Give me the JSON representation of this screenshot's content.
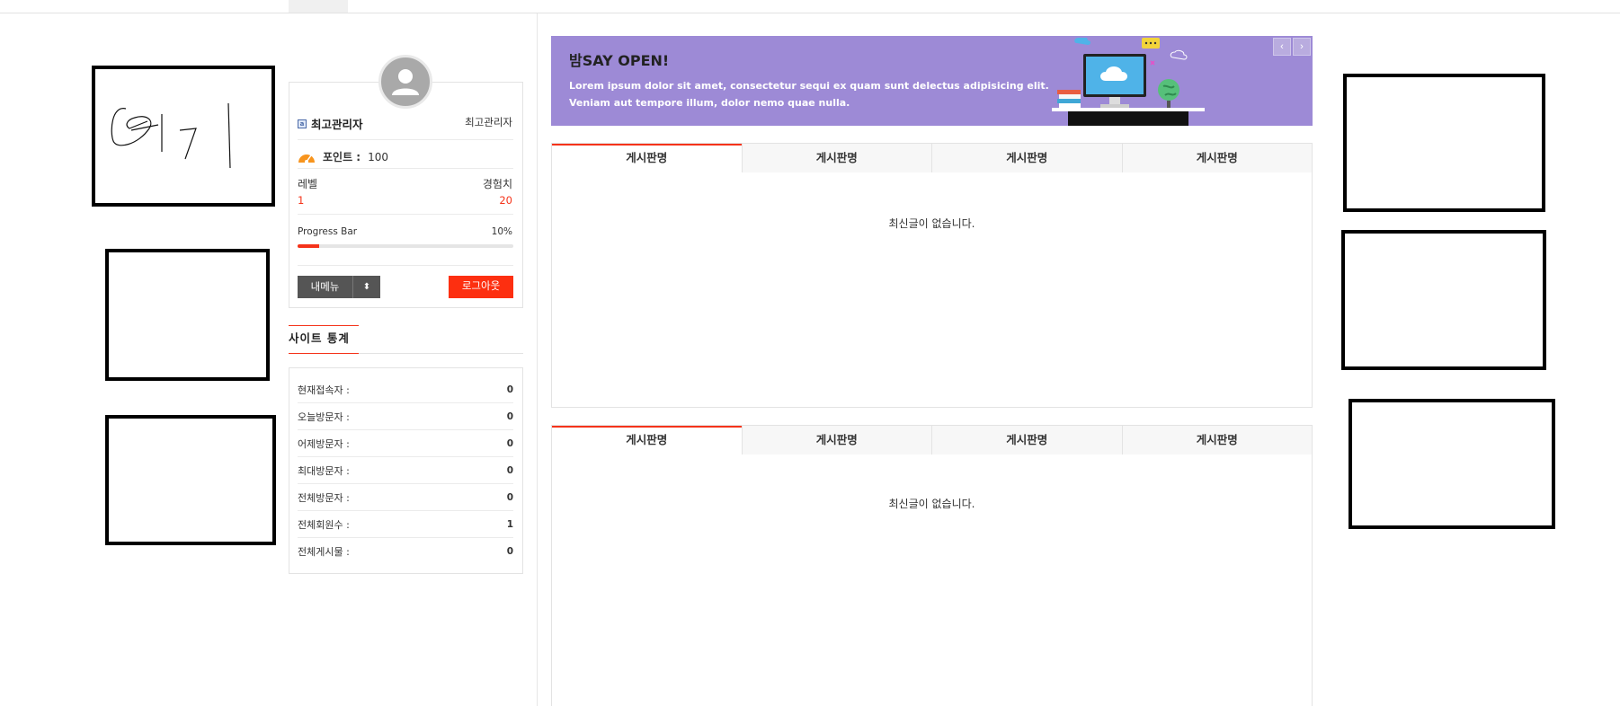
{
  "profile": {
    "name": "최고관리자",
    "role": "최고관리자",
    "points_label": "포인트 :",
    "points_value": "100",
    "level_label": "레벨",
    "level_value": "1",
    "exp_label": "경험치",
    "exp_value": "20",
    "progress_label": "Progress Bar",
    "progress_text": "10%",
    "progress_fraction": 0.1,
    "mymenu_label": "내메뉴",
    "logout_label": "로그아웃"
  },
  "stats": {
    "title": "사이트 통계",
    "rows": [
      {
        "label": "현재접속자 :",
        "value": "0"
      },
      {
        "label": "오늘방문자 :",
        "value": "0"
      },
      {
        "label": "어제방문자 :",
        "value": "0"
      },
      {
        "label": "최대방문자 :",
        "value": "0"
      },
      {
        "label": "전체방문자 :",
        "value": "0"
      },
      {
        "label": "전체회원수 :",
        "value": "1"
      },
      {
        "label": "전체게시물 :",
        "value": "0"
      }
    ]
  },
  "banner": {
    "title": "밤SAY OPEN!",
    "line1": "Lorem ipsum dolor sit amet, consectetur sequi ex quam sunt delectus adipisicing elit.",
    "line2": "Veniam aut tempore illum, dolor nemo quae nulla.",
    "prev_label": "‹",
    "next_label": "›"
  },
  "boards": [
    {
      "tabs": [
        "게시판명",
        "게시판명",
        "게시판명",
        "게시판명"
      ],
      "empty": "최신글이 없습니다."
    },
    {
      "tabs": [
        "게시판명",
        "게시판명",
        "게시판명",
        "게시판명"
      ],
      "empty": "최신글이 없습니다."
    }
  ],
  "handwritten_note": "여기",
  "colors": {
    "accent": "#f5331a",
    "banner": "#9d8ad6",
    "logout": "#fd2f10"
  }
}
